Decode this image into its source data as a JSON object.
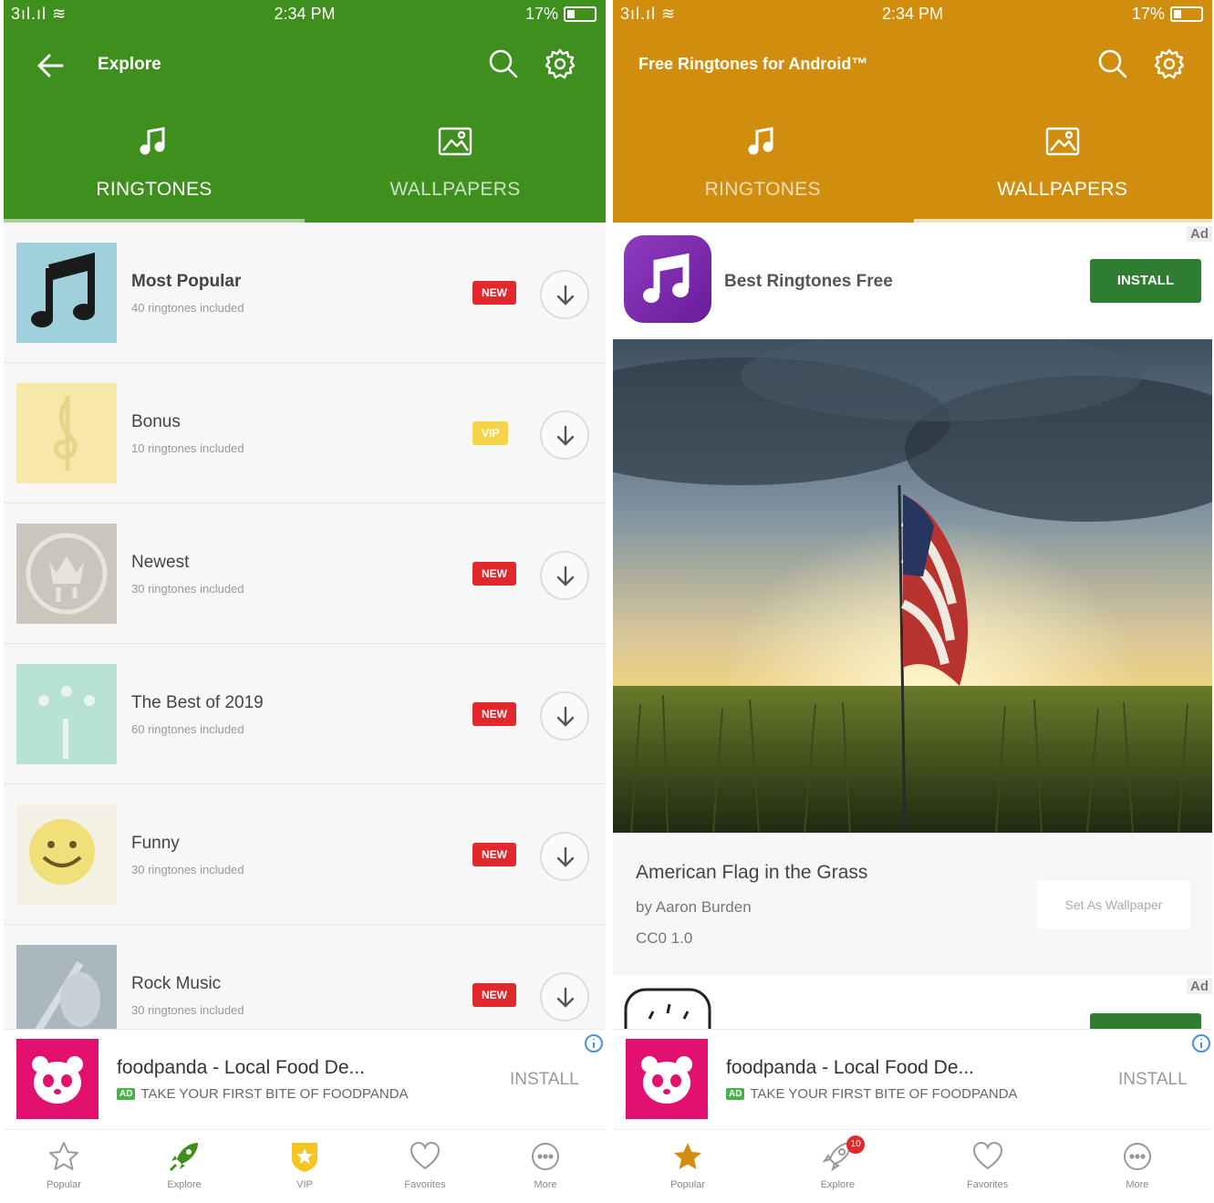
{
  "status_bar": {
    "signal": "3ıl.ıl ≋",
    "time": "2:34 PM",
    "battery": "17%"
  },
  "left": {
    "header": {
      "title": "Explore",
      "color": "#3f8f1f"
    },
    "tabs": [
      {
        "label": "RINGTONES",
        "icon": "music-note-icon",
        "active": true
      },
      {
        "label": "WALLPAPERS",
        "icon": "image-icon",
        "active": false
      }
    ],
    "list": [
      {
        "name": "Most Popular",
        "sub": "40 ringtones included",
        "badge": "NEW"
      },
      {
        "name": "Bonus",
        "sub": "10 ringtones included",
        "badge": "VIP"
      },
      {
        "name": "Newest",
        "sub": "30 ringtones included",
        "badge": "NEW"
      },
      {
        "name": "The Best of 2019",
        "sub": "60 ringtones included",
        "badge": "NEW"
      },
      {
        "name": "Funny",
        "sub": "30 ringtones included",
        "badge": "NEW"
      },
      {
        "name": "Rock Music",
        "sub": "30 ringtones included",
        "badge": "NEW"
      }
    ],
    "ad": {
      "title": "foodpanda - Local Food De...",
      "tag_chip": "AD",
      "tagline": "TAKE YOUR FIRST BITE OF FOODPANDA",
      "install": "INSTALL"
    },
    "nav": [
      {
        "label": "Popular",
        "icon": "star-outline-icon"
      },
      {
        "label": "Explore",
        "icon": "rocket-icon"
      },
      {
        "label": "VIP",
        "icon": "vip-shield-icon"
      },
      {
        "label": "Favorites",
        "icon": "heart-icon"
      },
      {
        "label": "More",
        "icon": "more-icon"
      }
    ]
  },
  "right": {
    "header": {
      "title": "Free Ringtones for Android™",
      "color": "#d18e0e"
    },
    "tabs": [
      {
        "label": "RINGTONES",
        "icon": "music-note-icon",
        "active": false
      },
      {
        "label": "WALLPAPERS",
        "icon": "image-icon",
        "active": true
      }
    ],
    "ad_top": {
      "label": "Ad",
      "app_name": "Best Ringtones Free",
      "install": "INSTALL"
    },
    "photo": {
      "title": "American Flag in the Grass",
      "author": "by Aaron Burden",
      "license": "CC0 1.0",
      "action": "Set As Wallpaper"
    },
    "ad_second": {
      "label": "Ad"
    },
    "ad": {
      "title": "foodpanda - Local Food De...",
      "tag_chip": "AD",
      "tagline": "TAKE YOUR FIRST BITE OF FOODPANDA",
      "install": "INSTALL"
    },
    "nav": [
      {
        "label": "Popular",
        "icon": "star-filled-icon"
      },
      {
        "label": "Explore",
        "icon": "rocket-outline-icon",
        "badge": "10"
      },
      {
        "label": "Favorites",
        "icon": "heart-icon"
      },
      {
        "label": "More",
        "icon": "more-icon"
      }
    ]
  }
}
